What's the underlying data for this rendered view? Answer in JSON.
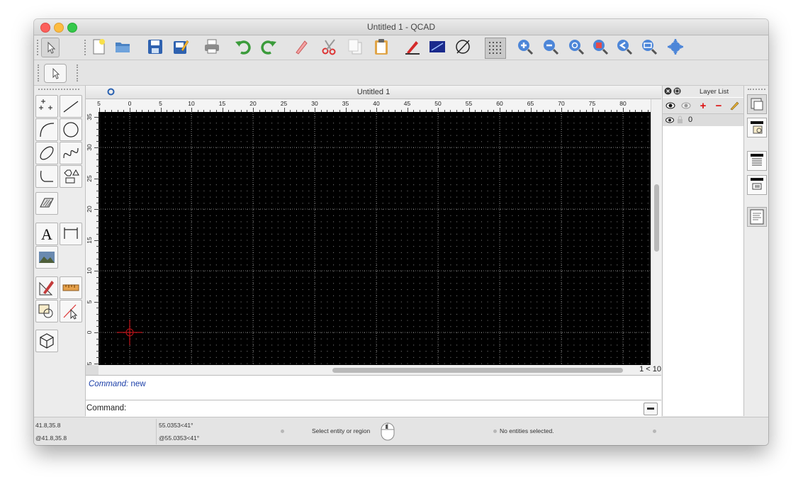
{
  "window": {
    "title": "Untitled 1 - QCAD"
  },
  "toolbar": {
    "icons": [
      "select-pointer",
      "new-file",
      "open-folder",
      "save",
      "save-as",
      "print",
      "undo",
      "redo",
      "erase-pen",
      "cut",
      "copy",
      "paste",
      "draft-mode",
      "toggle-grid-view",
      "crosshair",
      "grid-dots",
      "zoom-in",
      "zoom-out",
      "auto-zoom",
      "zoom-selection",
      "zoom-previous",
      "zoom-window",
      "pan"
    ]
  },
  "document": {
    "tab_title": "Untitled 1",
    "ruler_h_labels": [
      "5",
      "0",
      "5",
      "10",
      "15",
      "20",
      "25",
      "30",
      "35",
      "40",
      "45",
      "50",
      "55",
      "60",
      "65",
      "70",
      "75",
      "80"
    ],
    "ruler_v_labels": [
      "35",
      "30",
      "25",
      "20",
      "15",
      "10",
      "5",
      "0",
      "5"
    ],
    "scale": "1 < 10"
  },
  "left_toolbar": {
    "icons": [
      "point",
      "line",
      "arc",
      "circle",
      "ellipse",
      "spline",
      "polyline",
      "shape",
      "hatch",
      "text",
      "dimension",
      "image",
      "modify",
      "measure",
      "snap",
      "select-tool",
      "block"
    ]
  },
  "command": {
    "history_prefix": "Command:",
    "history_value": "new",
    "label": "Command:",
    "input_value": ""
  },
  "layer_panel": {
    "title": "Layer List",
    "layers": [
      {
        "name": "0"
      }
    ]
  },
  "status": {
    "abs_coord": "41.8,35.8",
    "rel_coord": "@41.8,35.8",
    "polar": "55.0353<41°",
    "rel_polar": "@55.0353<41°",
    "prompt": "Select entity or region",
    "selection": "No entities selected."
  },
  "colors": {
    "canvas": "#000000",
    "crosshair": "#c0141a",
    "grid_dot": "#8a8a8a",
    "command_text": "#1a3ea8"
  }
}
